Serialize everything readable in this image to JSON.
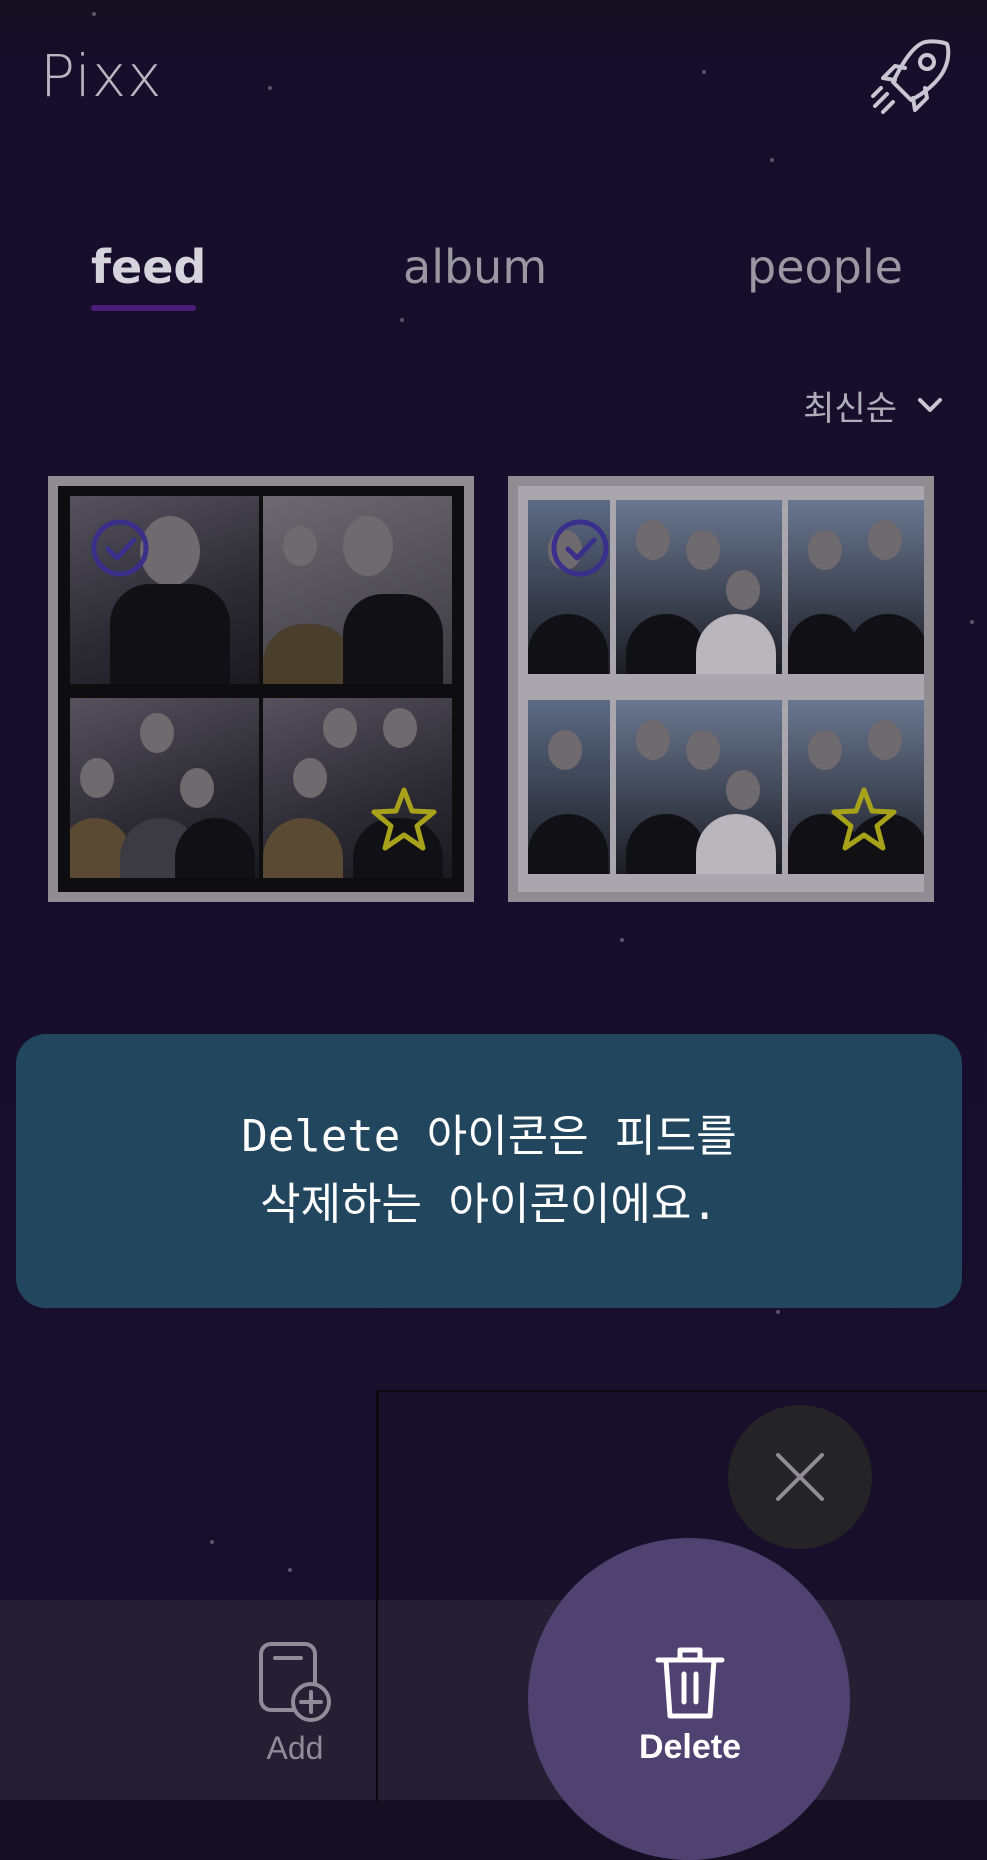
{
  "app": {
    "title": "Pixx"
  },
  "tabs": [
    {
      "label": "feed",
      "active": true
    },
    {
      "label": "album",
      "active": false
    },
    {
      "label": "people",
      "active": false
    }
  ],
  "sort": {
    "selected": "최신순",
    "icon": "chevron-down-icon"
  },
  "feed": {
    "items": [
      {
        "selected": true,
        "favorite": true
      },
      {
        "selected": true,
        "favorite": true
      }
    ]
  },
  "tooltip": {
    "line1": "Delete 아이콘은 피드를",
    "line2": "삭제하는 아이콘이에요."
  },
  "actions": {
    "add_label": "Add",
    "delete_label": "Delete"
  },
  "colors": {
    "accent": "#4b1d7a",
    "tooltip_bg": "#23465f",
    "delete_highlight": "#4f4270",
    "check": "#3a2f8a",
    "star": "#a8a21a"
  }
}
